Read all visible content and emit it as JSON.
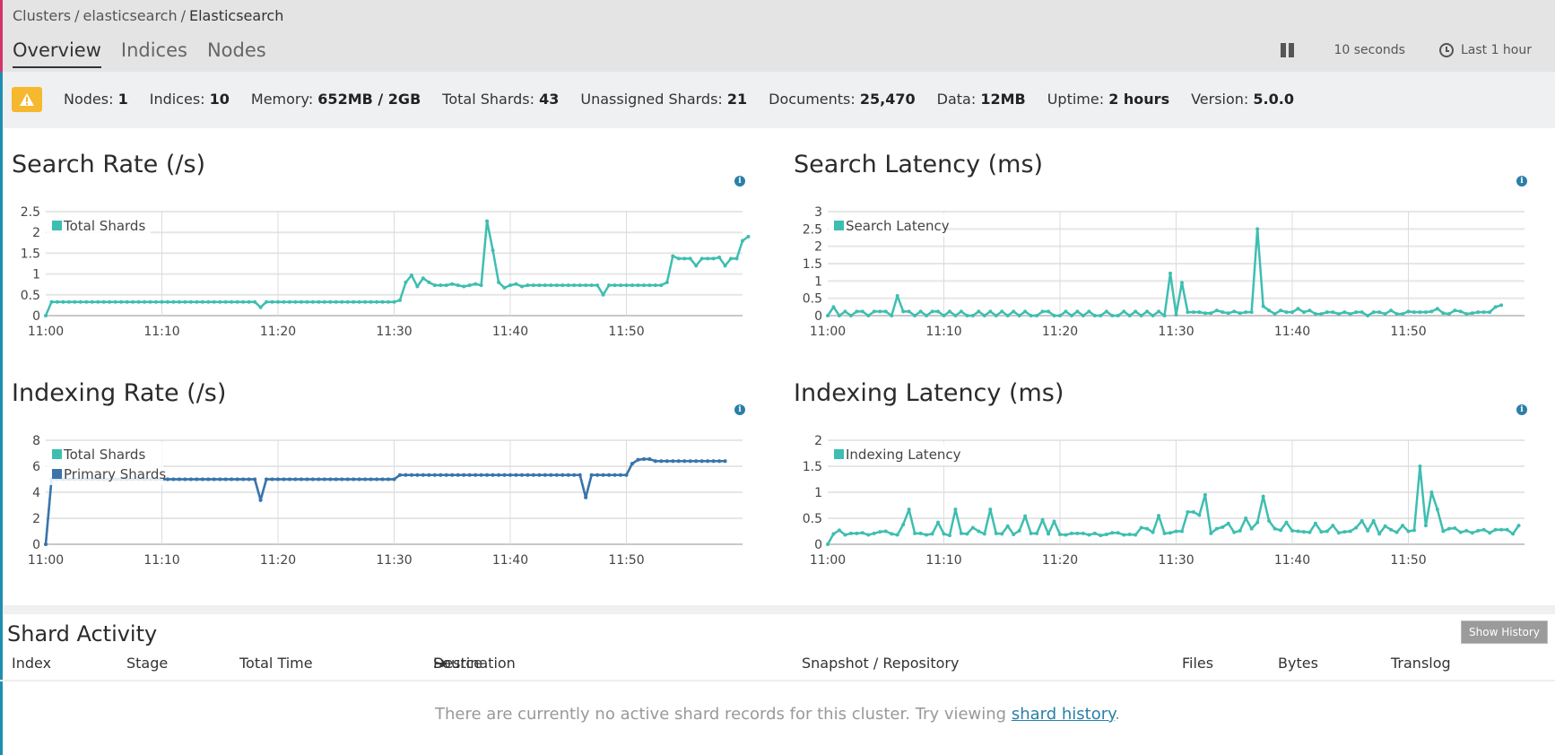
{
  "breadcrumb": {
    "items": [
      "Clusters",
      "elasticsearch",
      "Elasticsearch"
    ],
    "separator": "/"
  },
  "tabs": [
    {
      "label": "Overview",
      "active": true
    },
    {
      "label": "Indices",
      "active": false
    },
    {
      "label": "Nodes",
      "active": false
    }
  ],
  "toolbar": {
    "pause_icon": "pause-icon",
    "refresh_interval": "10 seconds",
    "time_icon": "clock-icon",
    "time_range": "Last 1 hour"
  },
  "status": {
    "health_icon": "warning-icon",
    "health_color": "#f5b82e",
    "stats": [
      {
        "label": "Nodes:",
        "value": "1"
      },
      {
        "label": "Indices:",
        "value": "10"
      },
      {
        "label": "Memory:",
        "value": "652MB / 2GB"
      },
      {
        "label": "Total Shards:",
        "value": "43"
      },
      {
        "label": "Unassigned Shards:",
        "value": "21"
      },
      {
        "label": "Documents:",
        "value": "25,470"
      },
      {
        "label": "Data:",
        "value": "12MB"
      },
      {
        "label": "Uptime:",
        "value": "2 hours"
      },
      {
        "label": "Version:",
        "value": "5.0.0"
      }
    ]
  },
  "colors": {
    "teal": "#3ebeb0",
    "blue": "#3b73ac",
    "info": "#2a7fa8",
    "link": "#2a7fa8"
  },
  "chart_data": [
    {
      "id": "search-rate",
      "type": "line",
      "title": "Search Rate (/s)",
      "xlabel": "",
      "ylabel": "",
      "x_start": "11:00",
      "x_step_minutes": 0.5,
      "x_ticks": [
        "11:00",
        "11:10",
        "11:20",
        "11:30",
        "11:40",
        "11:50"
      ],
      "y_ticks": [
        "0",
        "0.5",
        "1",
        "1.5",
        "2",
        "2.5"
      ],
      "ylim": [
        0,
        2.5
      ],
      "grid": true,
      "legend": "top-left",
      "series": [
        {
          "name": "Total Shards",
          "color": "#3ebeb0",
          "values": [
            0,
            0.33,
            0.33,
            0.33,
            0.33,
            0.33,
            0.33,
            0.33,
            0.33,
            0.33,
            0.33,
            0.33,
            0.33,
            0.33,
            0.33,
            0.33,
            0.33,
            0.33,
            0.33,
            0.33,
            0.33,
            0.33,
            0.33,
            0.33,
            0.33,
            0.33,
            0.33,
            0.33,
            0.33,
            0.33,
            0.33,
            0.33,
            0.33,
            0.33,
            0.33,
            0.33,
            0.33,
            0.2,
            0.33,
            0.33,
            0.33,
            0.33,
            0.33,
            0.33,
            0.33,
            0.33,
            0.33,
            0.33,
            0.33,
            0.33,
            0.33,
            0.33,
            0.33,
            0.33,
            0.33,
            0.33,
            0.33,
            0.33,
            0.33,
            0.33,
            0.33,
            0.37,
            0.8,
            0.97,
            0.7,
            0.9,
            0.8,
            0.73,
            0.73,
            0.73,
            0.76,
            0.73,
            0.7,
            0.73,
            0.76,
            0.73,
            2.27,
            1.57,
            0.8,
            0.67,
            0.73,
            0.76,
            0.7,
            0.73,
            0.73,
            0.73,
            0.73,
            0.73,
            0.73,
            0.73,
            0.73,
            0.73,
            0.73,
            0.73,
            0.73,
            0.73,
            0.5,
            0.73,
            0.73,
            0.73,
            0.73,
            0.73,
            0.73,
            0.73,
            0.73,
            0.73,
            0.73,
            0.8,
            1.43,
            1.37,
            1.37,
            1.37,
            1.2,
            1.37,
            1.37,
            1.37,
            1.4,
            1.2,
            1.37,
            1.37,
            1.8,
            1.9
          ]
        }
      ]
    },
    {
      "id": "search-latency",
      "type": "line",
      "title": "Search Latency (ms)",
      "xlabel": "",
      "ylabel": "",
      "x_start": "11:00",
      "x_step_minutes": 0.5,
      "x_ticks": [
        "11:00",
        "11:10",
        "11:20",
        "11:30",
        "11:40",
        "11:50"
      ],
      "y_ticks": [
        "0",
        "0.5",
        "1",
        "1.5",
        "2",
        "2.5",
        "3"
      ],
      "ylim": [
        0,
        3
      ],
      "grid": true,
      "legend": "top-left",
      "series": [
        {
          "name": "Search Latency",
          "color": "#3ebeb0",
          "values": [
            0,
            0.25,
            0,
            0.12,
            0,
            0.12,
            0.12,
            0,
            0.12,
            0.12,
            0.12,
            0,
            0.57,
            0.12,
            0.12,
            0,
            0.12,
            0,
            0.12,
            0.12,
            0,
            0.12,
            0,
            0.12,
            0,
            0,
            0.12,
            0,
            0.12,
            0,
            0.12,
            0,
            0.12,
            0,
            0.12,
            0,
            0,
            0.12,
            0.12,
            0,
            0,
            0.12,
            0,
            0.12,
            0,
            0.12,
            0,
            0,
            0.12,
            0,
            0,
            0.12,
            0,
            0.12,
            0,
            0.12,
            0,
            0.12,
            0,
            1.22,
            0.03,
            0.95,
            0.1,
            0.1,
            0.1,
            0.07,
            0.07,
            0.15,
            0.1,
            0.07,
            0.12,
            0.07,
            0.1,
            0.1,
            2.5,
            0.27,
            0.15,
            0.05,
            0.15,
            0.1,
            0.1,
            0.2,
            0.1,
            0.15,
            0.05,
            0.05,
            0.1,
            0.1,
            0.05,
            0.1,
            0.05,
            0.1,
            0.1,
            0,
            0.1,
            0.1,
            0.05,
            0.15,
            0.05,
            0.05,
            0.12,
            0.1,
            0.1,
            0.1,
            0.12,
            0.2,
            0.07,
            0.05,
            0.15,
            0.12,
            0.05,
            0.07,
            0.1,
            0.1,
            0.1,
            0.25,
            0.3
          ]
        }
      ]
    },
    {
      "id": "indexing-rate",
      "type": "line",
      "title": "Indexing Rate (/s)",
      "xlabel": "",
      "ylabel": "",
      "x_start": "11:00",
      "x_step_minutes": 0.5,
      "x_ticks": [
        "11:00",
        "11:10",
        "11:20",
        "11:30",
        "11:40",
        "11:50"
      ],
      "y_ticks": [
        "0",
        "2",
        "4",
        "6",
        "8"
      ],
      "ylim": [
        0,
        8
      ],
      "grid": true,
      "legend": "top-left",
      "series": [
        {
          "name": "Total Shards",
          "color": "#3ebeb0",
          "values": [
            0,
            5,
            5,
            5,
            5,
            5,
            5,
            5,
            5,
            5,
            5,
            5,
            5,
            5,
            5,
            5,
            5,
            5,
            5,
            5,
            5,
            5,
            5,
            5,
            5,
            5,
            5,
            5,
            5,
            5,
            5,
            5,
            5,
            5,
            5,
            5,
            5,
            3.4,
            5,
            5,
            5,
            5,
            5,
            5,
            5,
            5,
            5,
            5,
            5,
            5,
            5,
            5,
            5,
            5,
            5,
            5,
            5,
            5,
            5,
            5,
            5,
            5.33,
            5.33,
            5.33,
            5.33,
            5.33,
            5.33,
            5.33,
            5.33,
            5.33,
            5.33,
            5.33,
            5.33,
            5.33,
            5.33,
            5.33,
            5.33,
            5.33,
            5.33,
            5.33,
            5.33,
            5.33,
            5.33,
            5.33,
            5.33,
            5.33,
            5.33,
            5.33,
            5.33,
            5.33,
            5.33,
            5.33,
            5.33,
            3.6,
            5.33,
            5.33,
            5.33,
            5.33,
            5.33,
            5.33,
            5.33,
            6.2,
            6.5,
            6.55,
            6.55,
            6.4,
            6.4,
            6.4,
            6.4,
            6.4,
            6.4,
            6.4,
            6.4,
            6.4,
            6.4,
            6.4,
            6.4,
            6.4
          ]
        },
        {
          "name": "Primary Shards",
          "color": "#3b73ac",
          "values": [
            0,
            5,
            5,
            5,
            5,
            5,
            5,
            5,
            5,
            5,
            5,
            5,
            5,
            5,
            5,
            5,
            5,
            5,
            5,
            5,
            5,
            5,
            5,
            5,
            5,
            5,
            5,
            5,
            5,
            5,
            5,
            5,
            5,
            5,
            5,
            5,
            5,
            3.4,
            5,
            5,
            5,
            5,
            5,
            5,
            5,
            5,
            5,
            5,
            5,
            5,
            5,
            5,
            5,
            5,
            5,
            5,
            5,
            5,
            5,
            5,
            5,
            5.33,
            5.33,
            5.33,
            5.33,
            5.33,
            5.33,
            5.33,
            5.33,
            5.33,
            5.33,
            5.33,
            5.33,
            5.33,
            5.33,
            5.33,
            5.33,
            5.33,
            5.33,
            5.33,
            5.33,
            5.33,
            5.33,
            5.33,
            5.33,
            5.33,
            5.33,
            5.33,
            5.33,
            5.33,
            5.33,
            5.33,
            5.33,
            3.6,
            5.33,
            5.33,
            5.33,
            5.33,
            5.33,
            5.33,
            5.33,
            6.2,
            6.5,
            6.55,
            6.55,
            6.4,
            6.4,
            6.4,
            6.4,
            6.4,
            6.4,
            6.4,
            6.4,
            6.4,
            6.4,
            6.4,
            6.4,
            6.4
          ]
        }
      ]
    },
    {
      "id": "indexing-latency",
      "type": "line",
      "title": "Indexing Latency (ms)",
      "xlabel": "",
      "ylabel": "",
      "x_start": "11:00",
      "x_step_minutes": 0.5,
      "x_ticks": [
        "11:00",
        "11:10",
        "11:20",
        "11:30",
        "11:40",
        "11:50"
      ],
      "y_ticks": [
        "0",
        "0.5",
        "1",
        "1.5",
        "2"
      ],
      "ylim": [
        0,
        2
      ],
      "grid": true,
      "legend": "top-left",
      "series": [
        {
          "name": "Indexing Latency",
          "color": "#3ebeb0",
          "values": [
            0,
            0.2,
            0.27,
            0.18,
            0.21,
            0.21,
            0.22,
            0.18,
            0.21,
            0.24,
            0.25,
            0.2,
            0.18,
            0.38,
            0.67,
            0.21,
            0.21,
            0.18,
            0.2,
            0.42,
            0.2,
            0.17,
            0.67,
            0.21,
            0.2,
            0.32,
            0.25,
            0.2,
            0.67,
            0.21,
            0.2,
            0.35,
            0.19,
            0.26,
            0.54,
            0.21,
            0.21,
            0.47,
            0.2,
            0.44,
            0.19,
            0.18,
            0.21,
            0.21,
            0.21,
            0.18,
            0.21,
            0.17,
            0.19,
            0.22,
            0.22,
            0.18,
            0.19,
            0.18,
            0.32,
            0.3,
            0.23,
            0.55,
            0.21,
            0.22,
            0.25,
            0.25,
            0.62,
            0.62,
            0.56,
            0.95,
            0.21,
            0.3,
            0.33,
            0.4,
            0.23,
            0.26,
            0.5,
            0.3,
            0.42,
            0.92,
            0.45,
            0.3,
            0.27,
            0.42,
            0.26,
            0.25,
            0.24,
            0.23,
            0.4,
            0.24,
            0.25,
            0.36,
            0.22,
            0.24,
            0.25,
            0.32,
            0.45,
            0.26,
            0.45,
            0.2,
            0.35,
            0.28,
            0.23,
            0.36,
            0.25,
            0.27,
            1.5,
            0.36,
            1.0,
            0.67,
            0.25,
            0.3,
            0.31,
            0.23,
            0.26,
            0.22,
            0.26,
            0.28,
            0.22,
            0.28,
            0.28,
            0.28,
            0.2,
            0.36
          ]
        }
      ]
    }
  ],
  "shard_activity": {
    "title": "Shard Activity",
    "show_history_label": "Show History",
    "columns": {
      "index": "Index",
      "stage": "Stage",
      "total_time": "Total Time",
      "source": "Source",
      "destination": "Destination",
      "snapshot": "Snapshot / Repository",
      "files": "Files",
      "bytes": "Bytes",
      "translog": "Translog"
    },
    "arrow_icon": "arrow-right-icon",
    "empty_message": "There are currently no active shard records for this cluster. Try viewing ",
    "empty_link": "shard history",
    "empty_suffix": "."
  }
}
